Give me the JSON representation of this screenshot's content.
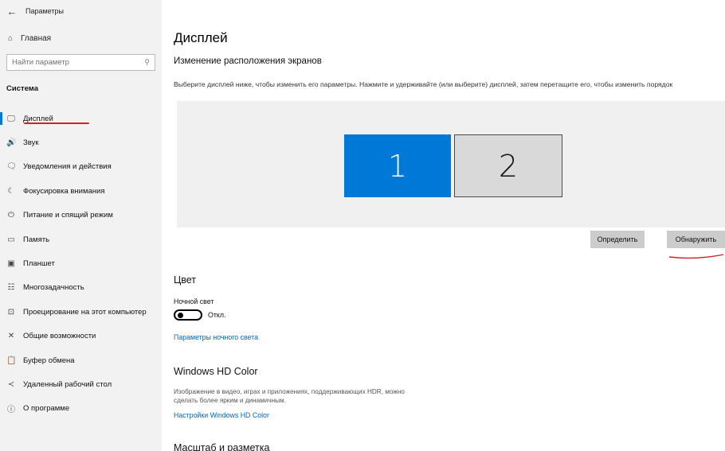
{
  "window": {
    "title": "Параметры",
    "back_icon": "back-arrow-icon"
  },
  "sidebar": {
    "home": {
      "label": "Главная",
      "icon": "home-icon"
    },
    "search": {
      "placeholder": "Найти параметр",
      "icon": "search-icon"
    },
    "section": "Система",
    "items": [
      {
        "label": "Дисплей",
        "icon": "monitor-icon",
        "glyph": "🖵",
        "active": true
      },
      {
        "label": "Звук",
        "icon": "speaker-icon",
        "glyph": "🔊"
      },
      {
        "label": "Уведомления и действия",
        "icon": "notification-icon",
        "glyph": "🗨"
      },
      {
        "label": "Фокусировка внимания",
        "icon": "moon-icon",
        "glyph": "☾"
      },
      {
        "label": "Питание и спящий режим",
        "icon": "power-icon",
        "glyph": "⏻"
      },
      {
        "label": "Память",
        "icon": "storage-icon",
        "glyph": "▭"
      },
      {
        "label": "Планшет",
        "icon": "tablet-icon",
        "glyph": "▣"
      },
      {
        "label": "Многозадачность",
        "icon": "multitasking-icon",
        "glyph": "☷"
      },
      {
        "label": "Проецирование на этот компьютер",
        "icon": "projection-icon",
        "glyph": "⊡"
      },
      {
        "label": "Общие возможности",
        "icon": "shared-experiences-icon",
        "glyph": "✕"
      },
      {
        "label": "Буфер обмена",
        "icon": "clipboard-icon",
        "glyph": "📋"
      },
      {
        "label": "Удаленный рабочий стол",
        "icon": "remote-desktop-icon",
        "glyph": "≺"
      },
      {
        "label": "О программе",
        "icon": "info-icon",
        "glyph": "ⓘ"
      }
    ]
  },
  "main": {
    "title": "Дисплей",
    "subtitle": "Изменение расположения экранов",
    "instruction": "Выберите дисплей ниже, чтобы изменить его параметры. Нажмите и удерживайте (или выберите) дисплей, затем перетащите его, чтобы изменить порядок",
    "monitors": [
      "1",
      "2"
    ],
    "identify_label": "Определить",
    "detect_label": "Обнаружить",
    "color_heading": "Цвет",
    "night_light_label": "Ночной свет",
    "night_light_state": "Откл.",
    "night_light_link": "Параметры ночного света",
    "hdr_heading": "Windows HD Color",
    "hdr_description": "Изображение в видео, играх и приложениях, поддерживающих HDR, можно сделать более ярким и динамичным.",
    "hdr_link": "Настройки Windows HD Color",
    "scale_heading": "Масштаб и разметка"
  },
  "colors": {
    "accent": "#0078d7",
    "sidebar_bg": "#f2f2f2",
    "annotation_red": "#d62020",
    "link": "#0067c0"
  }
}
